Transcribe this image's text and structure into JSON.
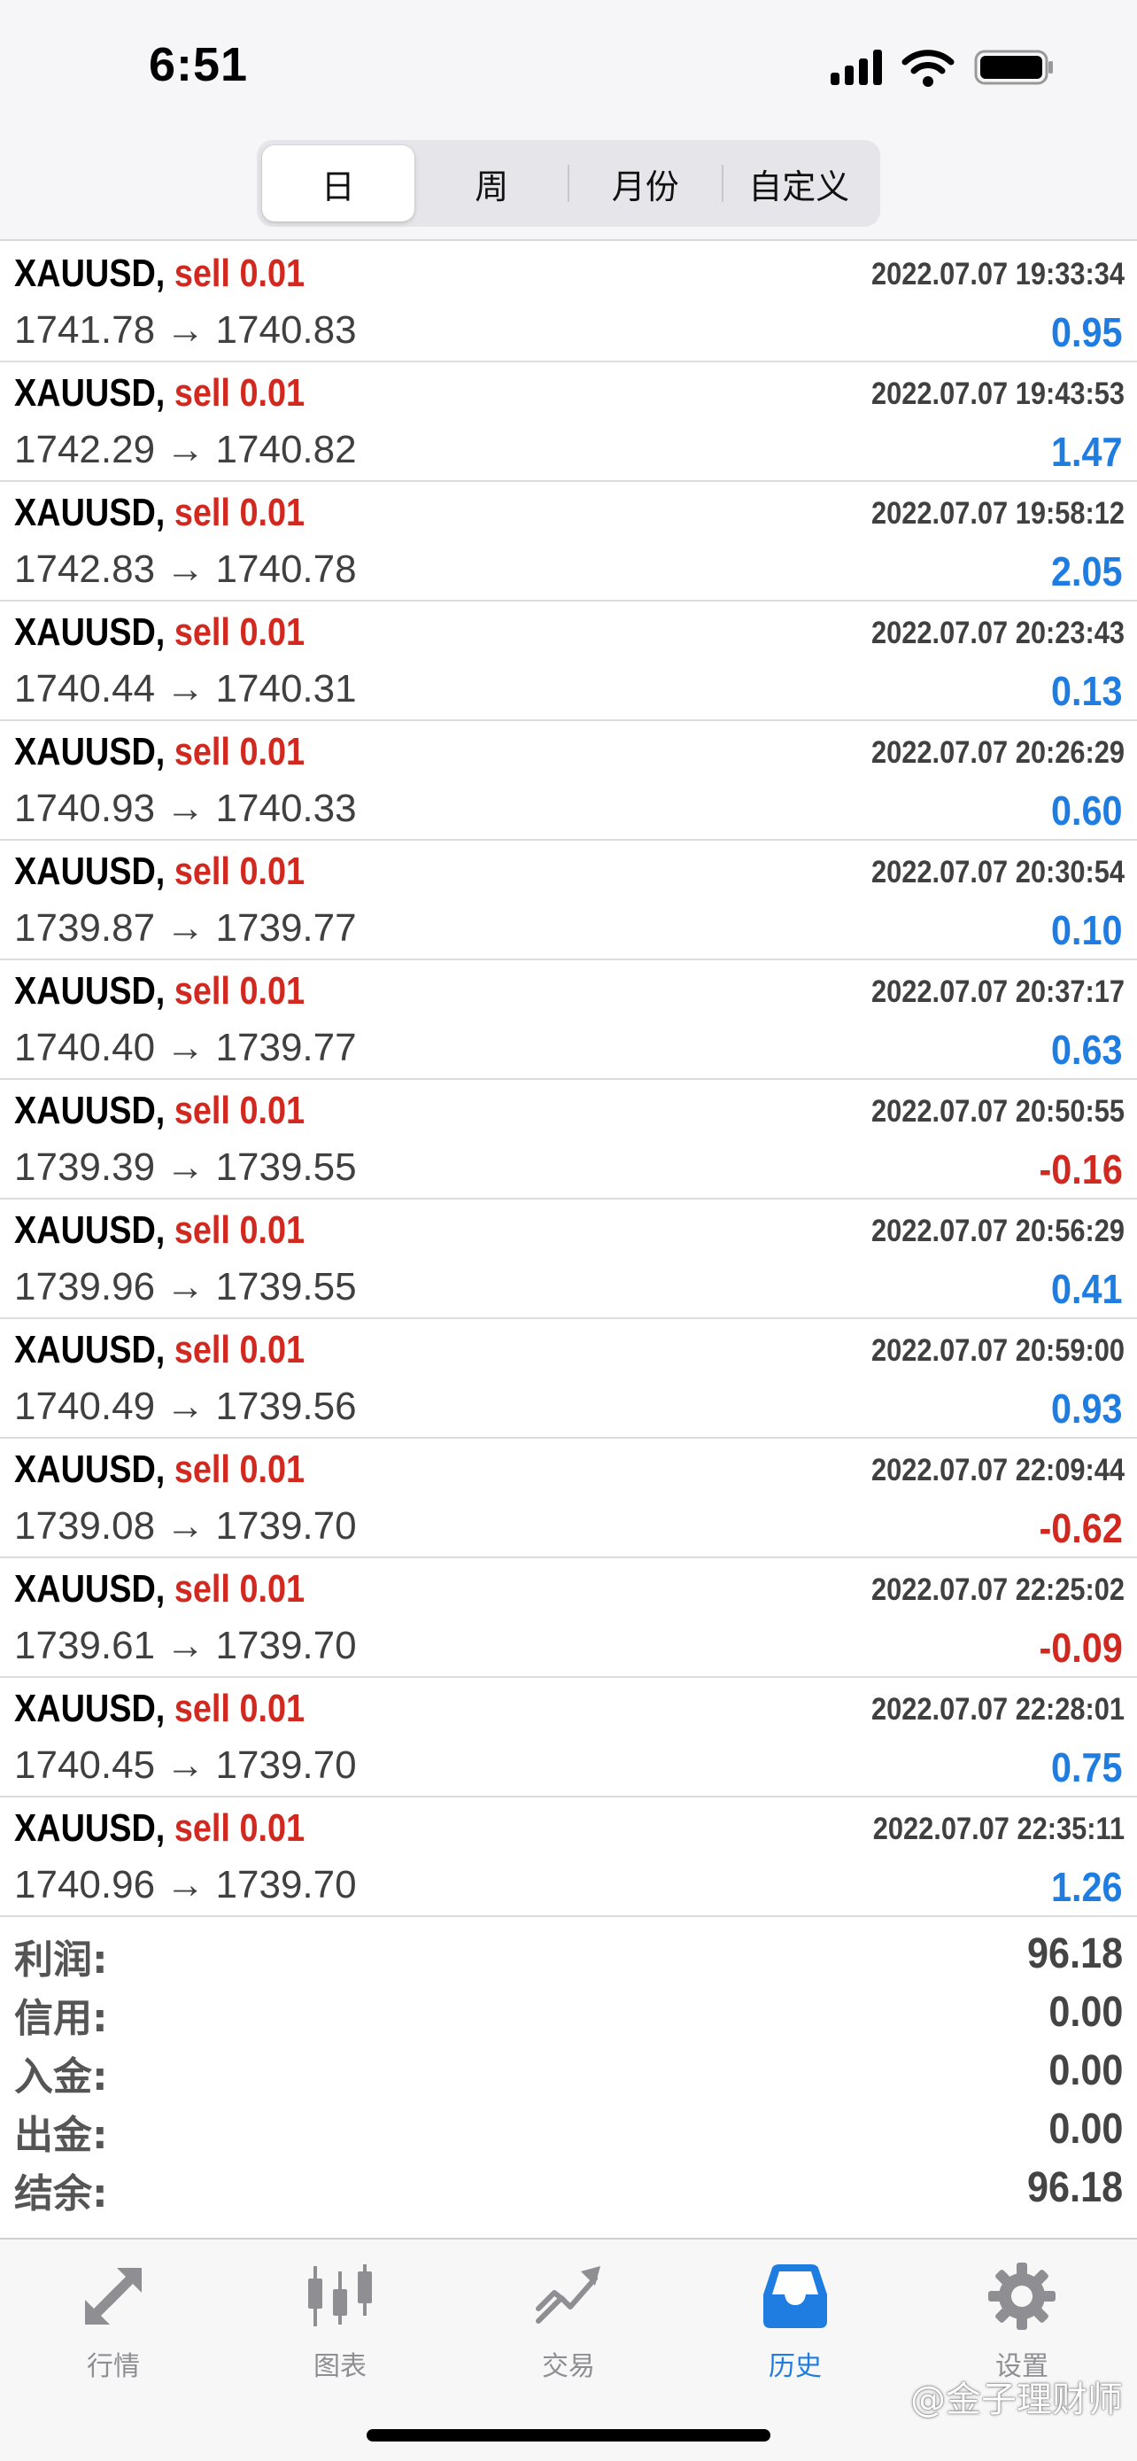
{
  "status_bar": {
    "time": "6:51"
  },
  "segments": [
    {
      "label": "日",
      "active": true
    },
    {
      "label": "周",
      "active": false
    },
    {
      "label": "月份",
      "active": false
    },
    {
      "label": "自定义",
      "active": false
    }
  ],
  "orders": [
    {
      "symbol": "XAUUSD,",
      "side": "sell 0.01",
      "time": "2022.07.07 19:33:34",
      "open": "1741.78",
      "close": "1740.83",
      "profit": "0.95"
    },
    {
      "symbol": "XAUUSD,",
      "side": "sell 0.01",
      "time": "2022.07.07 19:43:53",
      "open": "1742.29",
      "close": "1740.82",
      "profit": "1.47"
    },
    {
      "symbol": "XAUUSD,",
      "side": "sell 0.01",
      "time": "2022.07.07 19:58:12",
      "open": "1742.83",
      "close": "1740.78",
      "profit": "2.05"
    },
    {
      "symbol": "XAUUSD,",
      "side": "sell 0.01",
      "time": "2022.07.07 20:23:43",
      "open": "1740.44",
      "close": "1740.31",
      "profit": "0.13"
    },
    {
      "symbol": "XAUUSD,",
      "side": "sell 0.01",
      "time": "2022.07.07 20:26:29",
      "open": "1740.93",
      "close": "1740.33",
      "profit": "0.60"
    },
    {
      "symbol": "XAUUSD,",
      "side": "sell 0.01",
      "time": "2022.07.07 20:30:54",
      "open": "1739.87",
      "close": "1739.77",
      "profit": "0.10"
    },
    {
      "symbol": "XAUUSD,",
      "side": "sell 0.01",
      "time": "2022.07.07 20:37:17",
      "open": "1740.40",
      "close": "1739.77",
      "profit": "0.63"
    },
    {
      "symbol": "XAUUSD,",
      "side": "sell 0.01",
      "time": "2022.07.07 20:50:55",
      "open": "1739.39",
      "close": "1739.55",
      "profit": "-0.16"
    },
    {
      "symbol": "XAUUSD,",
      "side": "sell 0.01",
      "time": "2022.07.07 20:56:29",
      "open": "1739.96",
      "close": "1739.55",
      "profit": "0.41"
    },
    {
      "symbol": "XAUUSD,",
      "side": "sell 0.01",
      "time": "2022.07.07 20:59:00",
      "open": "1740.49",
      "close": "1739.56",
      "profit": "0.93"
    },
    {
      "symbol": "XAUUSD,",
      "side": "sell 0.01",
      "time": "2022.07.07 22:09:44",
      "open": "1739.08",
      "close": "1739.70",
      "profit": "-0.62"
    },
    {
      "symbol": "XAUUSD,",
      "side": "sell 0.01",
      "time": "2022.07.07 22:25:02",
      "open": "1739.61",
      "close": "1739.70",
      "profit": "-0.09"
    },
    {
      "symbol": "XAUUSD,",
      "side": "sell 0.01",
      "time": "2022.07.07 22:28:01",
      "open": "1740.45",
      "close": "1739.70",
      "profit": "0.75"
    },
    {
      "symbol": "XAUUSD,",
      "side": "sell 0.01",
      "time": "2022.07.07 22:35:11",
      "open": "1740.96",
      "close": "1739.70",
      "profit": "1.26"
    }
  ],
  "arrow": "→",
  "summary": [
    {
      "label": "利润:",
      "value": "96.18"
    },
    {
      "label": "信用:",
      "value": "0.00"
    },
    {
      "label": "入金:",
      "value": "0.00"
    },
    {
      "label": "出金:",
      "value": "0.00"
    },
    {
      "label": "结余:",
      "value": "96.18"
    }
  ],
  "tabs": [
    {
      "label": "行情",
      "icon": "quotes-arrows-icon",
      "active": false
    },
    {
      "label": "图表",
      "icon": "candlestick-chart-icon",
      "active": false
    },
    {
      "label": "交易",
      "icon": "trade-trend-icon",
      "active": false
    },
    {
      "label": "历史",
      "icon": "history-inbox-icon",
      "active": true
    },
    {
      "label": "设置",
      "icon": "gear-icon",
      "active": false
    }
  ],
  "watermark": "@金子理财师",
  "colors": {
    "sell": "#d1281f",
    "profit_positive": "#1f7ce0",
    "profit_negative": "#d1281f",
    "tab_active": "#1f7ce0",
    "tab_inactive": "#8e8e93"
  }
}
